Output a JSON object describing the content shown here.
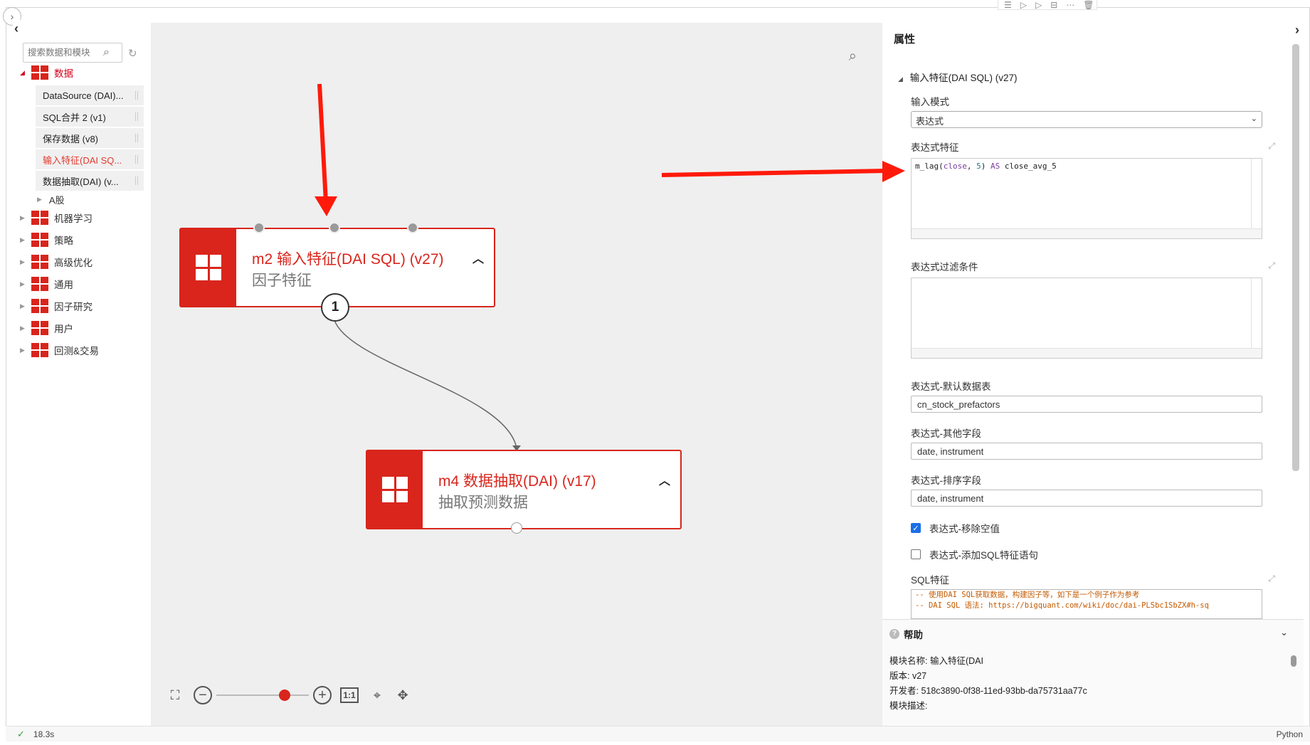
{
  "sidebar": {
    "search_placeholder": "搜索数据和模块",
    "categories": [
      {
        "label": "数据"
      },
      {
        "label": "机器学习"
      },
      {
        "label": "策略"
      },
      {
        "label": "高级优化"
      },
      {
        "label": "通用"
      },
      {
        "label": "因子研究"
      },
      {
        "label": "用户"
      },
      {
        "label": "回测&交易"
      }
    ],
    "data_items": [
      {
        "label": "DataSource (DAI)..."
      },
      {
        "label": "SQL合并 2 (v1)"
      },
      {
        "label": "保存数据 (v8)"
      },
      {
        "label": "输入特征(DAI SQ..."
      },
      {
        "label": "数据抽取(DAI) (v..."
      }
    ],
    "a_share": "A股"
  },
  "canvas": {
    "nodes": [
      {
        "title": "m2 输入特征(DAI SQL) (v27)",
        "subtitle": "因子特征",
        "badge": "1"
      },
      {
        "title": "m4 数据抽取(DAI) (v17)",
        "subtitle": "抽取预测数据"
      }
    ],
    "zoom": {
      "ratio_label": "1:1",
      "slider_level": 0.74
    }
  },
  "properties": {
    "title": "属性",
    "section_title": "输入特征(DAI SQL) (v27)",
    "input_mode_label": "输入模式",
    "input_mode_value": "表达式",
    "expr_features_label": "表达式特征",
    "expr_code": {
      "fn": "m_lag(",
      "arg": "close",
      "sep": ", ",
      "num": "5",
      "close": ") ",
      "as": "AS",
      "alias": " close_avg_5"
    },
    "expr_filter_label": "表达式过滤条件",
    "default_table_label": "表达式-默认数据表",
    "default_table_value": "cn_stock_prefactors",
    "other_fields_label": "表达式-其他字段",
    "other_fields_value": "date, instrument",
    "sort_fields_label": "表达式-排序字段",
    "sort_fields_value": "date, instrument",
    "remove_null_label": "表达式-移除空值",
    "remove_null_checked": true,
    "add_sql_label": "表达式-添加SQL特征语句",
    "add_sql_checked": false,
    "sql_features_label": "SQL特征",
    "sql_lines": [
      "-- 使用DAI SQL获取数据，构建因子等，如下是一个例子作为参考",
      "-- DAI SQL 语法: https://bigquant.com/wiki/doc/dai-PLSbc1SbZX#h-sq"
    ]
  },
  "help": {
    "title": "帮助",
    "lines": [
      "模块名称: 输入特征(DAI",
      "版本: v27",
      "开发者: 518c3890-0f38-11ed-93bb-da75731aa77c",
      "模块描述:"
    ]
  },
  "status": {
    "time": "18.3s",
    "language": "Python"
  },
  "colors": {
    "accent": "#d9251c",
    "annotation_arrow": "#ff1a0a",
    "checkbox": "#1a6ee6"
  }
}
